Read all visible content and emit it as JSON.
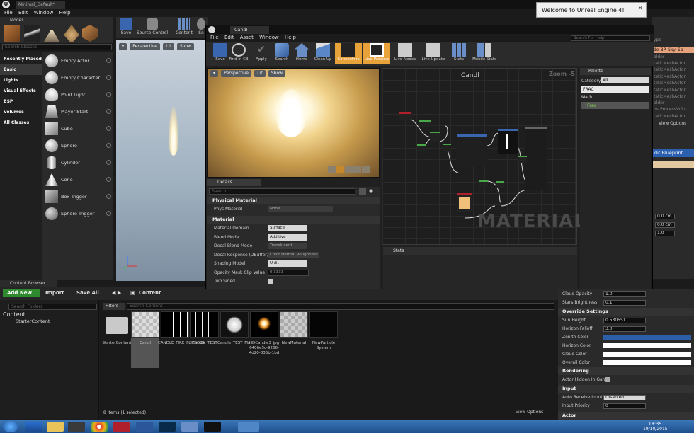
{
  "main_window": {
    "tab_title": "Minimal_Default*",
    "menu": [
      "File",
      "Edit",
      "Window",
      "Help"
    ]
  },
  "welcome": {
    "text": "Welcome to Unreal Engine 4!",
    "close": "×"
  },
  "modes": {
    "tab": "Modes",
    "search_placeholder": "Search Classes",
    "categories": [
      "Recently Placed",
      "Basic",
      "Lights",
      "Visual Effects",
      "BSP",
      "Volumes",
      "All Classes"
    ],
    "selected_category": "Basic",
    "items": [
      "Empty Actor",
      "Empty Character",
      "Point Light",
      "Player Start",
      "Cube",
      "Sphere",
      "Cylinder",
      "Cone",
      "Box Trigger",
      "Sphere Trigger"
    ]
  },
  "level_toolbar": {
    "save": "Save",
    "source_control": "Source Control",
    "content": "Content",
    "settings": "Se"
  },
  "level_viewport": {
    "perspective": "Perspective",
    "lit": "Lit",
    "show": "Show"
  },
  "right_strip": {
    "rows": [
      "ype",
      "de BP_Sky_Sp",
      "older",
      "taticMeshActor",
      "taticMeshActor",
      "taticMeshActor",
      "taticMeshActor",
      "taticMeshActor",
      "taticMeshActor",
      "older",
      "ostProcessVolu",
      "taticMeshActor"
    ],
    "view_options": "View Options",
    "blueprint": "dit Blueprint",
    "values": [
      "0.0 cm",
      "0.0 cm",
      "1.0"
    ]
  },
  "lower_right": {
    "cloud_opacity_label": "Cloud Opacity",
    "cloud_opacity": "1.0",
    "stars_brightness_label": "Stars Brightness",
    "stars_brightness": "0.1",
    "override_settings": "Override Settings",
    "sun_height_label": "Sun Height",
    "sun_height": "0.530551",
    "horizon_falloff_label": "Horizon Falloff",
    "horizon_falloff": "3.0",
    "zenith_color_label": "Zenith Color",
    "zenith_color": "#2c5fa8",
    "horizon_color_label": "Horizon Color",
    "horizon_color": "#ffffff",
    "cloud_color_label": "Cloud Color",
    "cloud_color": "#ffffff",
    "overall_color_label": "Overall Color",
    "overall_color": "#ffffff",
    "rendering": "Rendering",
    "actor_hidden_label": "Actor Hidden In Game",
    "input": "Input",
    "auto_receive_label": "Auto Receive Input",
    "auto_receive": "Disabled",
    "input_priority_label": "Input Priority",
    "input_priority": "0",
    "actor": "Actor"
  },
  "content_browser": {
    "tab": "Content Browser",
    "add_new": "Add New",
    "import": "Import",
    "save_all": "Save All",
    "path": "Content",
    "tree_search": "Search Folders",
    "tree": [
      "Content",
      "StarterContent"
    ],
    "filters": "Filters",
    "search_placeholder": "Search Content",
    "assets": [
      "StarterContent",
      "Candl",
      "CANDLE_FIRE_FLIPBOOK",
      "Candle_TEST",
      "Candle_TEST_Mat",
      "HDCandle3_jpg 6406e5c-9266-4d20-835b-1bd",
      "NewMaterial",
      "NewParticle System"
    ],
    "item_count": "8 items (1 selected)",
    "view_options": "View Options"
  },
  "material_editor": {
    "tab": "Candl",
    "menu": [
      "File",
      "Edit",
      "Asset",
      "Window",
      "Help"
    ],
    "search_help": "Search For Help",
    "toolbar": [
      "Save",
      "Find in CB",
      "Apply",
      "Search",
      "Home",
      "Clean Up",
      "Connectors",
      "Live Preview",
      "Live Nodes",
      "Live Update",
      "Stats",
      "Mobile Stats"
    ],
    "preview": {
      "perspective": "Perspective",
      "lit": "Lit",
      "show": "Show"
    },
    "details_tab": "Details",
    "details_search": "Search",
    "physical_material": "Physical Material",
    "phys_material_label": "Phys Material",
    "phys_material": "None",
    "material": "Material",
    "rows": [
      {
        "label": "Material Domain",
        "value": "Surface"
      },
      {
        "label": "Blend Mode",
        "value": "Additive"
      },
      {
        "label": "Decal Blend Mode",
        "value": "Translucent"
      },
      {
        "label": "Decal Response (DBuffer)",
        "value": "Color Normal Roughness"
      },
      {
        "label": "Shading Model",
        "value": "Unlit"
      },
      {
        "label": "Opacity Mask Clip Value",
        "value": "0.3333"
      },
      {
        "label": "Two Sided",
        "value": ""
      }
    ],
    "graph_title": "Candl",
    "zoom": "Zoom -5",
    "watermark": "MATERIAL",
    "stats_tab": "Stats",
    "palette": {
      "tab": "Palette",
      "category_label": "Category:",
      "category": "All",
      "search": "FRAC",
      "group": "Math",
      "result": "Frac"
    }
  },
  "taskbar": {
    "time": "18:35",
    "date": "19/10/2015"
  }
}
